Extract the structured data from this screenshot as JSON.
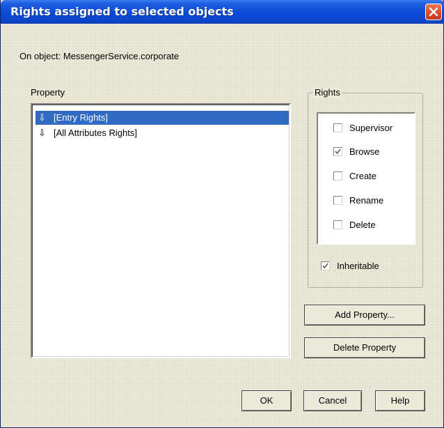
{
  "dialog": {
    "title": "Rights assigned to selected objects",
    "on_object": "On object: MessengerService.corporate"
  },
  "property": {
    "label": "Property",
    "items": [
      {
        "icon": "down-arrow-icon",
        "label": "[Entry Rights]",
        "selected": true
      },
      {
        "icon": "down-arrow-icon",
        "label": "[All Attributes Rights]",
        "selected": false
      }
    ]
  },
  "rights": {
    "label": "Rights",
    "items": [
      {
        "label": "Supervisor",
        "checked": false
      },
      {
        "label": "Browse",
        "checked": true
      },
      {
        "label": "Create",
        "checked": false
      },
      {
        "label": "Rename",
        "checked": false
      },
      {
        "label": "Delete",
        "checked": false
      }
    ],
    "inheritable": {
      "label": "Inheritable",
      "checked": true
    }
  },
  "buttons": {
    "add_property": "Add Property...",
    "delete_property": "Delete Property",
    "ok": "OK",
    "cancel": "Cancel",
    "help": "Help"
  },
  "colors": {
    "selection": "#316ac5",
    "titlebar": "#0c4bd6",
    "dialog_bg": "#ece9d8"
  }
}
